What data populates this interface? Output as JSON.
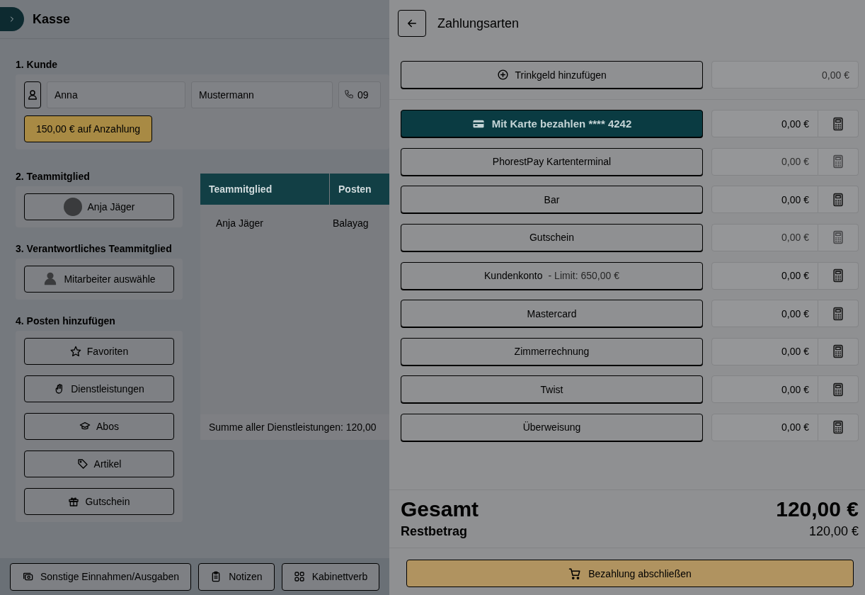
{
  "header": {
    "title": "Kasse"
  },
  "customer": {
    "heading": "1. Kunde",
    "first_name": "Anna",
    "last_name": "Mustermann",
    "phone": "09",
    "deposit_badge": "150,00 € auf Anzahlung"
  },
  "team_member": {
    "heading": "2. Teammitglied",
    "button": "Anja Jäger"
  },
  "responsible": {
    "heading": "3. Verantwortliches Teammitglied",
    "button": "Mitarbeiter auswähle"
  },
  "add_items": {
    "heading": "4. Posten hinzufügen",
    "buttons": [
      {
        "kind": "favorites",
        "label": "Favoriten"
      },
      {
        "kind": "services",
        "label": "Dienstleistungen"
      },
      {
        "kind": "subscriptions",
        "label": "Abos"
      },
      {
        "kind": "products",
        "label": "Artikel"
      },
      {
        "kind": "vouchers",
        "label": "Gutschein"
      }
    ]
  },
  "table": {
    "columns": [
      "Teammitglied",
      "Posten"
    ],
    "rows": [
      [
        "Anja Jäger",
        "Balayag"
      ]
    ],
    "summary": "Summe aller Dienstleistungen: 120,00"
  },
  "bottom_bar": {
    "buttons": [
      {
        "kind": "income",
        "label": "Sonstige Einnahmen/Ausgaben"
      },
      {
        "kind": "notes",
        "label": "Notizen"
      },
      {
        "kind": "grid",
        "label": "Kabinettverb"
      }
    ]
  },
  "payment_panel": {
    "title": "Zahlungsarten",
    "tip": {
      "label": "Trinkgeld hinzufügen",
      "amount": "0,00 €",
      "disabled": true
    },
    "methods": [
      {
        "kind": "card",
        "label": "Mit Karte bezahlen **** 4242",
        "amount": "0,00 €",
        "disabled": false
      },
      {
        "kind": "plain",
        "label": "PhorestPay Kartenterminal",
        "amount": "0,00 €",
        "disabled": true
      },
      {
        "kind": "plain",
        "label": "Bar",
        "amount": "0,00 €",
        "disabled": false
      },
      {
        "kind": "plain",
        "label": "Gutschein",
        "amount": "0,00 €",
        "disabled": true
      },
      {
        "kind": "plain",
        "label": "Kundenkonto",
        "note": "- Limit: 650,00 €",
        "amount": "0,00 €",
        "disabled": false
      },
      {
        "kind": "plain",
        "label": "Mastercard",
        "amount": "0,00 €",
        "disabled": false
      },
      {
        "kind": "plain",
        "label": "Zimmerrechnung",
        "amount": "0,00 €",
        "disabled": false
      },
      {
        "kind": "plain",
        "label": "Twist",
        "amount": "0,00 €",
        "disabled": false
      },
      {
        "kind": "plain",
        "label": "Überweisung",
        "amount": "0,00 €",
        "disabled": false
      }
    ],
    "total_label": "Gesamt",
    "total": "120,00 €",
    "remaining_label": "Restbetrag",
    "remaining": "120,00 €",
    "submit": "Bezahlung abschließen"
  }
}
